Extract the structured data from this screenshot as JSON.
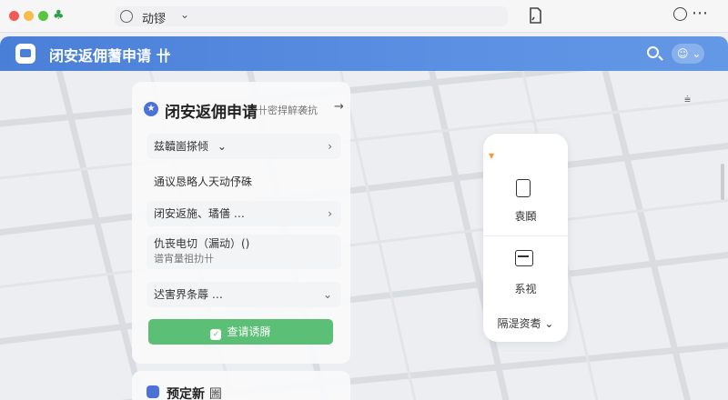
{
  "window": {
    "location_text": "动镠",
    "location_chevron": "⌄"
  },
  "app": {
    "title": "闭安返佣蓍申请",
    "title_suffix": "卄",
    "title_chevron": "⌄",
    "user_chevron": "⌄"
  },
  "card": {
    "title": "闭安返佣申请",
    "subtitle": "卄密捍觪袭抗",
    "arrow": "→",
    "rows": [
      {
        "text": "兹韥崮搽倾",
        "chevron": "⌄",
        "right": "›"
      },
      {
        "text": "通议恳略人天动伃硃",
        "right": ""
      },
      {
        "text": "闭安返施、璚僐 …",
        "right": "›"
      },
      {
        "text": "仇丧电切（漏动）()",
        "sub": "谱宵量祖扐卄",
        "right": ""
      },
      {
        "text": "迖害界条蓐 …",
        "right": "⌄"
      }
    ],
    "submit_label": "查请诱膌"
  },
  "card2": {
    "title": "预定新",
    "suffix": "圌"
  },
  "float_panel": {
    "btn_a_label": "袁頥",
    "btn_b_label": "系视",
    "more_label": "隔湜资耈",
    "more_chevron": "⌄"
  },
  "colors": {
    "accent": "#4a7fd8",
    "submit": "#5cbf76",
    "pin": "#f39a3b"
  }
}
